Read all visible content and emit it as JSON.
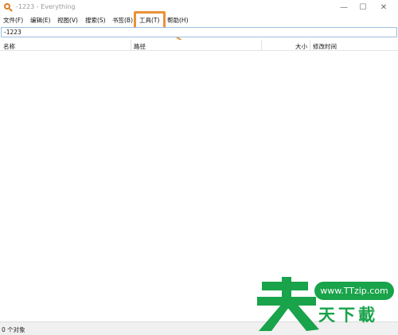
{
  "window": {
    "title": "-1223 - Everything",
    "minimize_glyph": "—",
    "maximize_glyph": "☐",
    "close_glyph": "✕"
  },
  "menu": {
    "items": [
      {
        "label": "文件(F)"
      },
      {
        "label": "编辑(E)"
      },
      {
        "label": "视图(V)"
      },
      {
        "label": "搜索(S)"
      },
      {
        "label": "书签(B)"
      },
      {
        "label": "工具(T)"
      },
      {
        "label": "帮助(H)"
      }
    ]
  },
  "search": {
    "value": "-1223"
  },
  "columns": {
    "name": "名称",
    "path": "路径",
    "size": "大小",
    "modified": "修改时间"
  },
  "status": {
    "text": "0 个对象"
  },
  "watermark": {
    "big_char": "天",
    "url": "www.TTzip.com",
    "sub": "天下載"
  },
  "colors": {
    "highlight": "#e8923a",
    "watermark_green": "#19a34a",
    "search_border": "#9dbedd"
  }
}
